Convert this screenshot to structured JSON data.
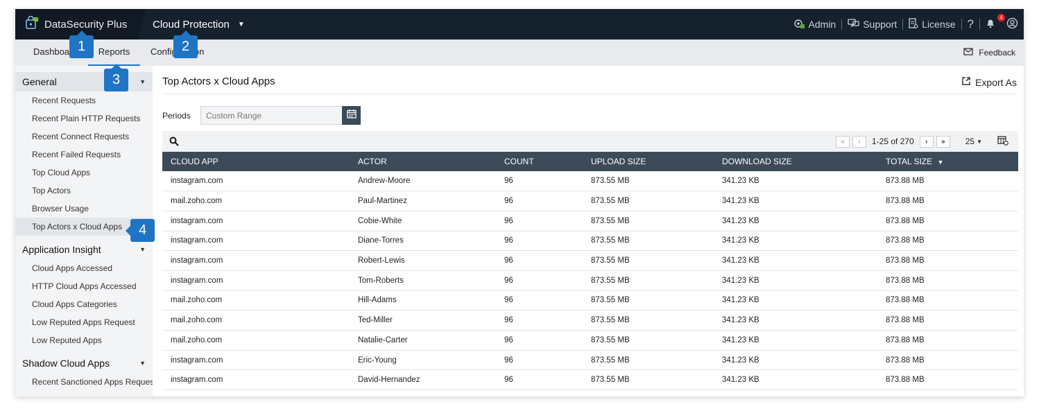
{
  "topbar": {
    "brand": "DataSecurity Plus",
    "module": "Cloud Protection",
    "admin": "Admin",
    "support": "Support",
    "license": "License",
    "help": "?",
    "notification_count": "4"
  },
  "nav": {
    "tabs": [
      {
        "label": "Dashboard"
      },
      {
        "label": "Reports"
      },
      {
        "label": "Configuration"
      }
    ],
    "feedback": "Feedback"
  },
  "sidebar": {
    "sections": [
      {
        "title": "General",
        "items": [
          "Recent Requests",
          "Recent Plain HTTP Requests",
          "Recent Connect Requests",
          "Recent Failed Requests",
          "Top Cloud Apps",
          "Top Actors",
          "Browser Usage",
          "Top Actors x Cloud Apps"
        ]
      },
      {
        "title": "Application Insight",
        "items": [
          "Cloud Apps Accessed",
          "HTTP Cloud Apps Accessed",
          "Cloud Apps Categories",
          "Low Reputed Apps Request",
          "Low Reputed Apps"
        ]
      },
      {
        "title": "Shadow Cloud Apps",
        "items": [
          "Recent Sanctioned Apps Request"
        ]
      }
    ]
  },
  "main": {
    "title": "Top Actors x Cloud Apps",
    "export_label": "Export As",
    "periods_label": "Periods",
    "period_placeholder": "Custom Range",
    "pager_range": "1-25 of 270",
    "per_page": "25"
  },
  "table": {
    "columns": [
      "CLOUD APP",
      "ACTOR",
      "COUNT",
      "UPLOAD SIZE",
      "DOWNLOAD SIZE",
      "TOTAL SIZE"
    ],
    "rows": [
      [
        "instagram.com",
        "Andrew-Moore",
        "96",
        "873.55 MB",
        "341.23 KB",
        "873.88 MB"
      ],
      [
        "mail.zoho.com",
        "Paul-Martinez",
        "96",
        "873.55 MB",
        "341.23 KB",
        "873.88 MB"
      ],
      [
        "instagram.com",
        "Cobie-White",
        "96",
        "873.55 MB",
        "341.23 KB",
        "873.88 MB"
      ],
      [
        "instagram.com",
        "Diane-Torres",
        "96",
        "873.55 MB",
        "341.23 KB",
        "873.88 MB"
      ],
      [
        "instagram.com",
        "Robert-Lewis",
        "96",
        "873.55 MB",
        "341.23 KB",
        "873.88 MB"
      ],
      [
        "instagram.com",
        "Tom-Roberts",
        "96",
        "873.55 MB",
        "341.23 KB",
        "873.88 MB"
      ],
      [
        "mail.zoho.com",
        "Hill-Adams",
        "96",
        "873.55 MB",
        "341.23 KB",
        "873.88 MB"
      ],
      [
        "mail.zoho.com",
        "Ted-Miller",
        "96",
        "873.55 MB",
        "341.23 KB",
        "873.88 MB"
      ],
      [
        "mail.zoho.com",
        "Natalie-Carter",
        "96",
        "873.55 MB",
        "341.23 KB",
        "873.88 MB"
      ],
      [
        "instagram.com",
        "Eric-Young",
        "96",
        "873.55 MB",
        "341.23 KB",
        "873.88 MB"
      ],
      [
        "instagram.com",
        "David-Hernandez",
        "96",
        "873.55 MB",
        "341.23 KB",
        "873.88 MB"
      ]
    ]
  },
  "callouts": [
    "1",
    "2",
    "3",
    "4"
  ],
  "colors": {
    "topbar": "#16212e",
    "table_header": "#3d4b59",
    "accent": "#1e6fd9",
    "callout": "#1f74c4"
  }
}
